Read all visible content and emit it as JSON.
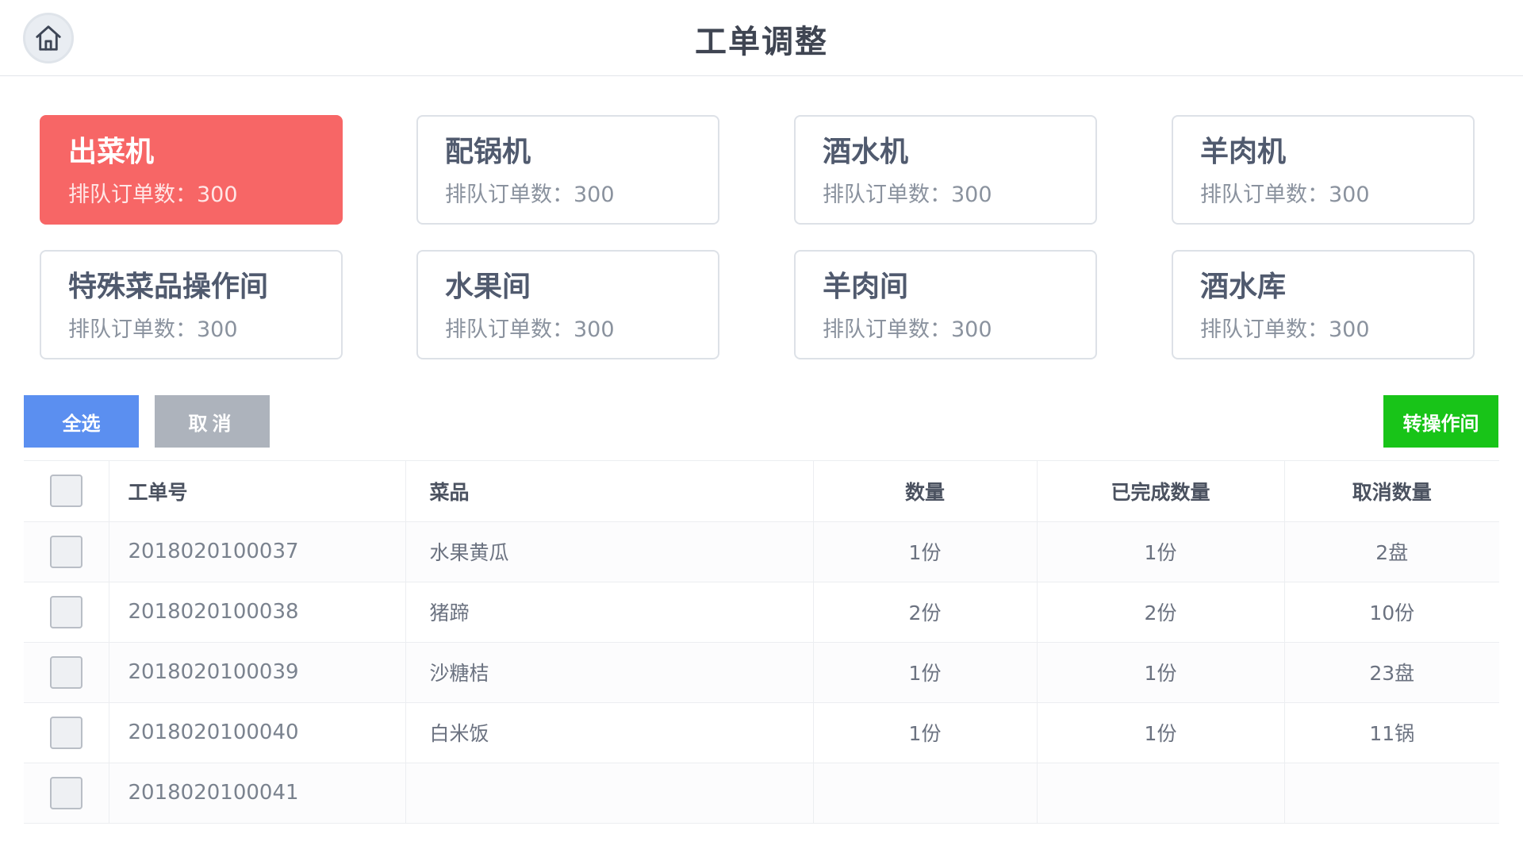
{
  "header": {
    "title": "工单调整"
  },
  "stations": [
    {
      "name": "出菜机",
      "queue": "排队订单数：300"
    },
    {
      "name": "配锅机",
      "queue": "排队订单数：300"
    },
    {
      "name": "酒水机",
      "queue": "排队订单数：300"
    },
    {
      "name": "羊肉机",
      "queue": "排队订单数：300"
    },
    {
      "name": "特殊菜品操作间",
      "queue": "排队订单数：300"
    },
    {
      "name": "水果间",
      "queue": "排队订单数：300"
    },
    {
      "name": "羊肉间",
      "queue": "排队订单数：300"
    },
    {
      "name": "酒水库",
      "queue": "排队订单数：300"
    }
  ],
  "toolbar": {
    "select_all": "全选",
    "cancel": "取消",
    "transfer": "转操作间"
  },
  "table": {
    "columns": {
      "order": "工单号",
      "dish": "菜品",
      "qty": "数量",
      "done": "已完成数量",
      "cancelled": "取消数量"
    },
    "rows": [
      {
        "order": "2018020100037",
        "dish": "水果黄瓜",
        "qty": "1份",
        "done": "1份",
        "cancelled": "2盘"
      },
      {
        "order": "2018020100038",
        "dish": "猪蹄",
        "qty": "2份",
        "done": "2份",
        "cancelled": "10份"
      },
      {
        "order": "2018020100039",
        "dish": "沙糖桔",
        "qty": "1份",
        "done": "1份",
        "cancelled": "23盘"
      },
      {
        "order": "2018020100040",
        "dish": "白米饭",
        "qty": "1份",
        "done": "1份",
        "cancelled": "11锅"
      },
      {
        "order": "2018020100041",
        "dish": "",
        "qty": "",
        "done": "",
        "cancelled": ""
      }
    ]
  },
  "colors": {
    "active_station": "#f76666",
    "select_all": "#5b8ff0",
    "cancel": "#adb3bc",
    "transfer": "#18c418"
  }
}
